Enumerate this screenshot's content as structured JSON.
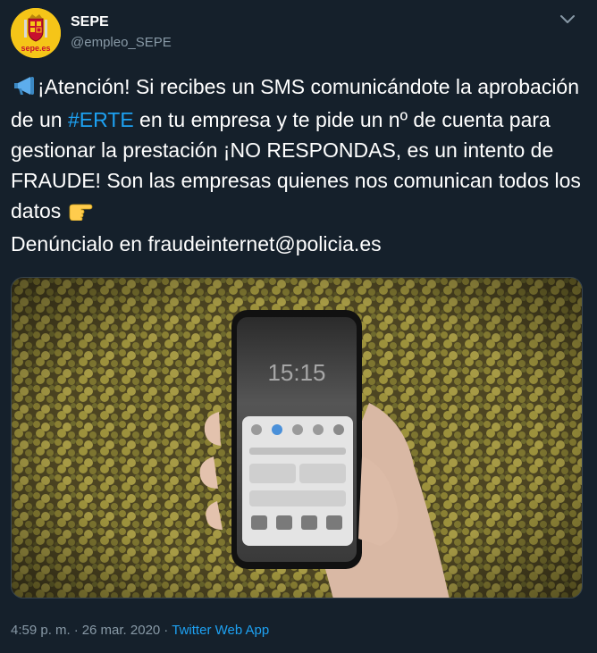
{
  "author": {
    "name": "SEPE",
    "handle": "@empleo_SEPE",
    "avatar_text": "sepe.es"
  },
  "tweet": {
    "text_before_hashtag": "¡Atención! Si recibes un SMS comunicándote la aprobación de un ",
    "hashtag": "#ERTE",
    "text_after_hashtag": " en tu empresa y te pide un nº de cuenta para gestionar la prestación ¡NO RESPONDAS, es un intento de FRAUDE! Son las empresas quienes nos comunican todos los datos ",
    "text_final": "Denúncialo en fraudeinternet@policia.es",
    "emoji_start": "megaphone-emoji",
    "emoji_point": "pointing-right-emoji"
  },
  "media": {
    "phone_time": "15:15"
  },
  "footer": {
    "time": "4:59 p. m.",
    "separator": "·",
    "date": "26 mar. 2020",
    "source": "Twitter Web App"
  },
  "colors": {
    "background": "#15202b",
    "accent": "#1da1f2",
    "secondary_text": "#8899a6"
  }
}
